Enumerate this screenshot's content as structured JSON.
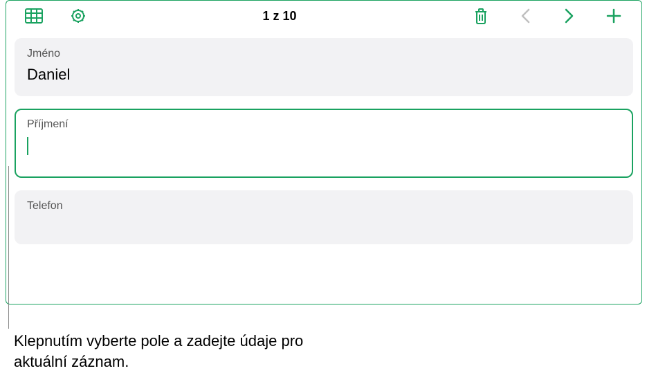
{
  "toolbar": {
    "title": "1 z 10"
  },
  "fields": {
    "name": {
      "label": "Jméno",
      "value": "Daniel"
    },
    "surname": {
      "label": "Příjmení",
      "value": ""
    },
    "phone": {
      "label": "Telefon",
      "value": ""
    }
  },
  "caption": "Klepnutím vyberte pole a zadejte údaje pro aktuální záznam.",
  "colors": {
    "accent": "#1aa260"
  }
}
